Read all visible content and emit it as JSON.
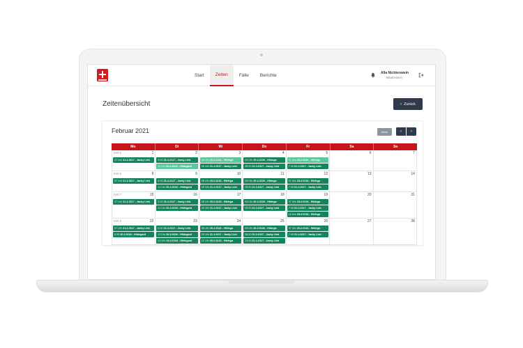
{
  "header": {
    "nav": [
      {
        "label": "Start",
        "active": false
      },
      {
        "label": "Zeiten",
        "active": true
      },
      {
        "label": "Fälle",
        "active": false
      },
      {
        "label": "Berichte",
        "active": false
      }
    ],
    "user_name": "Alla Nichtenwein",
    "user_role": "Mitarbeiterin"
  },
  "page": {
    "title": "Zeitenübersicht",
    "back_label": "Zurück"
  },
  "calendar": {
    "month_title": "Februar 2021",
    "today_label": "heute",
    "weekdays": [
      "Mo",
      "Di",
      "Mi",
      "Do",
      "Fr",
      "Sa",
      "So"
    ],
    "weeks": [
      {
        "kw": "KW 5",
        "days": [
          {
            "num": "1",
            "events": [
              {
                "time": "07 Uhr",
                "code": "21-1-0117",
                "name": "Jacky Lieb",
                "shade": "dark"
              }
            ]
          },
          {
            "num": "2",
            "events": [
              {
                "time": "8:30",
                "code": "21-1-0117",
                "name": "Jacky Lieb",
                "shade": "dark"
              },
              {
                "time": "11 Uhr",
                "code": "20-2-0116",
                "name": "Hildegard",
                "shade": "light"
              }
            ]
          },
          {
            "num": "3",
            "events": [
              {
                "time": "08 Uhr",
                "code": "20-2-0116",
                "name": "Hildega",
                "shade": "light"
              },
              {
                "time": "09 Uhr",
                "code": "21-1-0117",
                "name": "Jacky Lieb",
                "shade": "dark"
              }
            ]
          },
          {
            "num": "4",
            "events": [
              {
                "time": "08 Uhr",
                "code": "20-2-0116",
                "name": "Hildega",
                "shade": "dark"
              },
              {
                "time": "08:30",
                "code": "21-1-0117",
                "name": "Jacky Lieb",
                "shade": "dark"
              }
            ]
          },
          {
            "num": "5",
            "events": [
              {
                "time": "07 Uhr",
                "code": "20-2-0116",
                "name": "Hildega",
                "shade": "light"
              },
              {
                "time": "7:45",
                "code": "21-1-0117",
                "name": "Jacky Lieb",
                "shade": "dark"
              }
            ]
          },
          {
            "num": "6",
            "events": []
          },
          {
            "num": "7",
            "events": []
          }
        ]
      },
      {
        "kw": "KW 6",
        "days": [
          {
            "num": "8",
            "events": [
              {
                "time": "07 Uhr",
                "code": "21-1-0117",
                "name": "Jacky Lieb",
                "shade": "dark"
              }
            ]
          },
          {
            "num": "9",
            "events": [
              {
                "time": "8:30",
                "code": "21-1-0117",
                "name": "Jacky Lieb",
                "shade": "dark"
              },
              {
                "time": "11 Uhr",
                "code": "20-2-0116",
                "name": "Hildegard",
                "shade": "dark"
              }
            ]
          },
          {
            "num": "10",
            "events": [
              {
                "time": "08 Uhr",
                "code": "20-2-0116",
                "name": "Hildega",
                "shade": "dark"
              },
              {
                "time": "09 Uhr",
                "code": "21-1-0117",
                "name": "Jacky Lieb",
                "shade": "dark"
              }
            ]
          },
          {
            "num": "11",
            "events": [
              {
                "time": "08 Uhr",
                "code": "20-2-0116",
                "name": "Hildega",
                "shade": "dark"
              },
              {
                "time": "08:30",
                "code": "21-1-0117",
                "name": "Jacky Lieb",
                "shade": "dark"
              }
            ]
          },
          {
            "num": "12",
            "events": [
              {
                "time": "07 Uhr",
                "code": "20-2-0116",
                "name": "Hildega",
                "shade": "dark"
              },
              {
                "time": "7:45",
                "code": "21-1-0117",
                "name": "Jacky Lieb",
                "shade": "dark"
              }
            ]
          },
          {
            "num": "13",
            "events": []
          },
          {
            "num": "14",
            "events": []
          }
        ]
      },
      {
        "kw": "KW 7",
        "days": [
          {
            "num": "15",
            "events": [
              {
                "time": "07 Uhr",
                "code": "21-1-0117",
                "name": "Jacky Lieb",
                "shade": "dark"
              }
            ]
          },
          {
            "num": "16",
            "events": [
              {
                "time": "8:30",
                "code": "21-1-0117",
                "name": "Jacky Lieb",
                "shade": "dark"
              },
              {
                "time": "11 Uhr",
                "code": "20-2-0116",
                "name": "Hildegard",
                "shade": "dark"
              }
            ]
          },
          {
            "num": "17",
            "events": [
              {
                "time": "08 Uhr",
                "code": "20-2-0116",
                "name": "Hildega",
                "shade": "dark"
              },
              {
                "time": "09 Uhr",
                "code": "21-1-0117",
                "name": "Jacky Lieb",
                "shade": "dark"
              }
            ]
          },
          {
            "num": "18",
            "events": [
              {
                "time": "08 Uhr",
                "code": "20-2-0116",
                "name": "Hildega",
                "shade": "dark"
              },
              {
                "time": "08:30",
                "code": "21-1-0117",
                "name": "Jacky Lieb",
                "shade": "dark"
              }
            ]
          },
          {
            "num": "19",
            "events": [
              {
                "time": "07 Uhr",
                "code": "20-2-0116",
                "name": "Hildega",
                "shade": "dark"
              },
              {
                "time": "7:45",
                "code": "21-1-0117",
                "name": "Jacky Lieb",
                "shade": "dark"
              },
              {
                "time": "16 Uhr",
                "code": "20-2-0116",
                "name": "Hildega",
                "shade": "dark"
              }
            ]
          },
          {
            "num": "20",
            "events": []
          },
          {
            "num": "21",
            "events": []
          }
        ]
      },
      {
        "kw": "KW 8",
        "days": [
          {
            "num": "22",
            "events": [
              {
                "time": "07 Uhr",
                "code": "21-1-0117",
                "name": "Jacky Lieb",
                "shade": "dark"
              },
              {
                "time": "8:30",
                "code": "20-2-0116",
                "name": "Hildegard",
                "shade": "dark"
              }
            ]
          },
          {
            "num": "23",
            "events": [
              {
                "time": "8:30",
                "code": "21-1-0117",
                "name": "Jacky Lieb",
                "shade": "dark"
              },
              {
                "time": "11 Uhr",
                "code": "20-2-0116",
                "name": "Hildegard",
                "shade": "dark"
              },
              {
                "time": "14 Uhr",
                "code": "20-2-0116",
                "name": "Hildegard",
                "shade": "dark"
              }
            ]
          },
          {
            "num": "24",
            "events": [
              {
                "time": "08 Uhr",
                "code": "20-2-0116",
                "name": "Hildega",
                "shade": "dark"
              },
              {
                "time": "09 Uhr",
                "code": "21-1-0117",
                "name": "Jacky Lieb",
                "shade": "dark"
              },
              {
                "time": "12 Uhr",
                "code": "20-2-0116",
                "name": "Hildega",
                "shade": "dark"
              }
            ]
          },
          {
            "num": "25",
            "events": [
              {
                "time": "08 Uhr",
                "code": "20-2-0116",
                "name": "Hildega",
                "shade": "dark"
              },
              {
                "time": "08:30",
                "code": "21-1-0117",
                "name": "Jacky Lieb",
                "shade": "dark"
              },
              {
                "time": "15:45",
                "code": "21-1-0117",
                "name": "Jacky Lieb",
                "shade": "dark"
              }
            ]
          },
          {
            "num": "26",
            "events": [
              {
                "time": "07 Uhr",
                "code": "20-2-0116",
                "name": "Hildega",
                "shade": "dark"
              },
              {
                "time": "7:45",
                "code": "21-1-0117",
                "name": "Jacky Lieb",
                "shade": "dark"
              }
            ]
          },
          {
            "num": "27",
            "events": []
          },
          {
            "num": "28",
            "events": []
          }
        ]
      }
    ]
  }
}
